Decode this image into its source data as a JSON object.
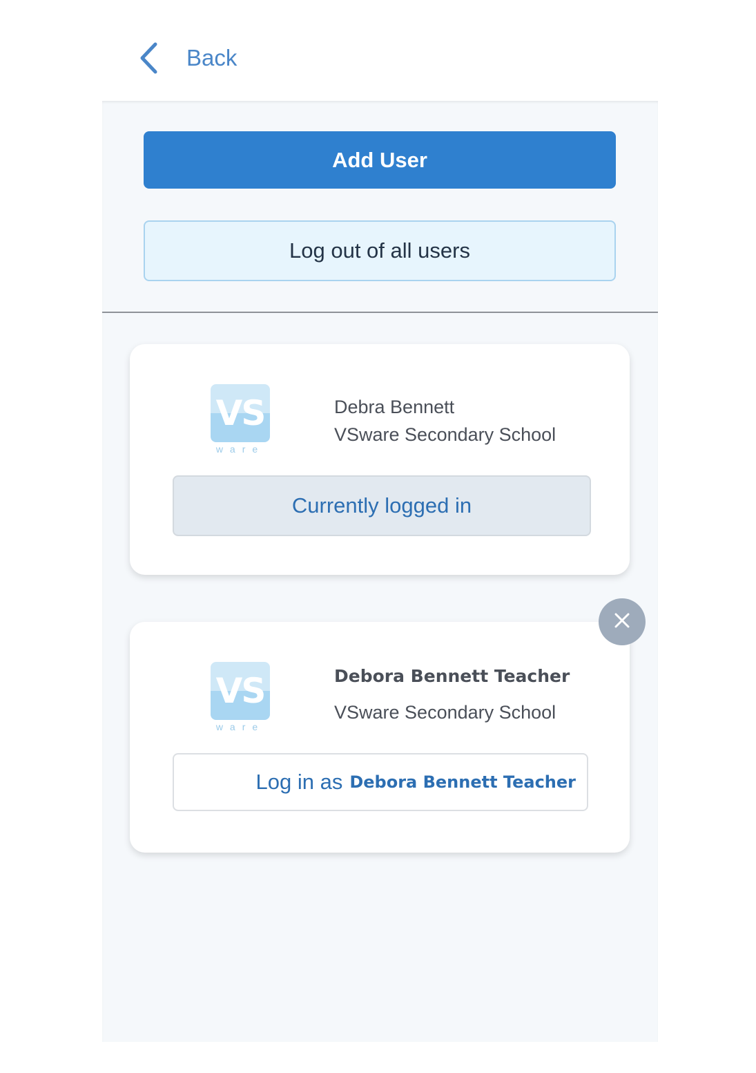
{
  "header": {
    "back_label": "Back"
  },
  "actions": {
    "add_user_label": "Add User",
    "logout_all_label": "Log out of all users"
  },
  "accounts": [
    {
      "user_name": "Debra Bennett",
      "school": "VSware Secondary School",
      "logo_text": "VS",
      "logo_sub": "ware",
      "status_label": "Currently logged in"
    },
    {
      "user_name": "Debora Bennett Teacher",
      "school": "VSware Secondary School",
      "logo_text": "VS",
      "logo_sub": "ware",
      "login_prefix": "Log in as",
      "login_name": "Debora Bennett Teacher"
    }
  ],
  "icons": {
    "back": "chevron-left-icon",
    "remove": "close-icon"
  },
  "colors": {
    "primary": "#2f80cf",
    "link": "#4a86c8",
    "panel_bg": "#f5f8fb",
    "remove_bg": "#9eabbb"
  }
}
